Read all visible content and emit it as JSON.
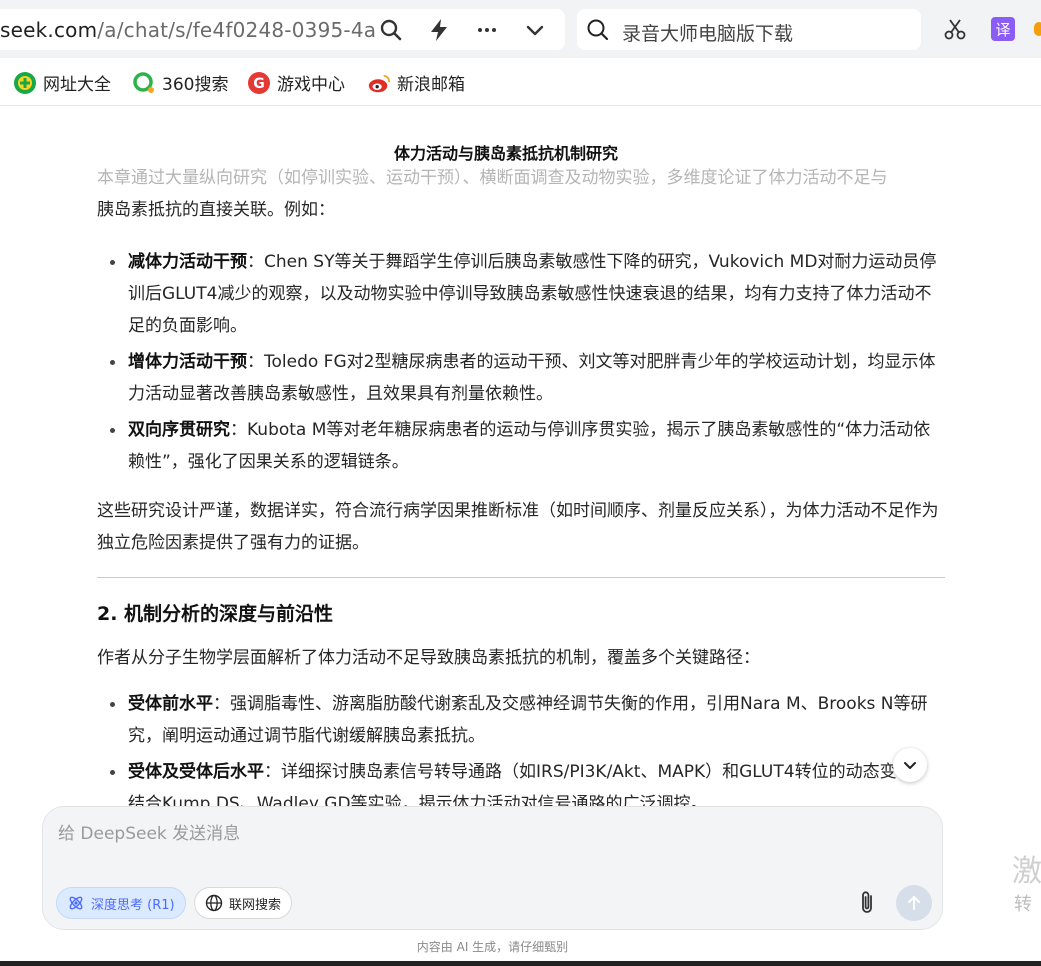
{
  "browser": {
    "url_host": "seek.com",
    "url_path": "/a/chat/s/fe4f0248-0395-4a",
    "search_placeholder": "录音大师电脑版下载",
    "translate_label": "译",
    "bookmarks": [
      {
        "label": "网址大全",
        "icon": "globe-plus-icon",
        "color": "#19a848"
      },
      {
        "label": "360搜索",
        "icon": "search-360-icon",
        "color": "#f5a623"
      },
      {
        "label": "游戏中心",
        "icon": "game-icon",
        "color": "#e53935"
      },
      {
        "label": "新浪邮箱",
        "icon": "sina-mail-icon",
        "color": "#e02e24"
      }
    ]
  },
  "document": {
    "title": "体力活动与胰岛素抵抗机制研究",
    "faded_line": "本章通过大量纵向研究（如停训实验、运动干预）、横断面调查及动物实验，多维度论证了体力活动不足与",
    "intro_rest": "胰岛素抵抗的直接关联。例如：",
    "bullets1": [
      {
        "bold": "减体力活动干预",
        "text": "：Chen SY等关于舞蹈学生停训后胰岛素敏感性下降的研究，Vukovich MD对耐力运动员停训后GLUT4减少的观察，以及动物实验中停训导致胰岛素敏感性快速衰退的结果，均有力支持了体力活动不足的负面影响。"
      },
      {
        "bold": "增体力活动干预",
        "text": "：Toledo FG对2型糖尿病患者的运动干预、刘文等对肥胖青少年的学校运动计划，均显示体力活动显著改善胰岛素敏感性，且效果具有剂量依赖性。"
      },
      {
        "bold": "双向序贯研究",
        "text": "：Kubota M等对老年糖尿病患者的运动与停训序贯实验，揭示了胰岛素敏感性的“体力活动依赖性”，强化了因果关系的逻辑链条。"
      }
    ],
    "conclusion": "这些研究设计严谨，数据详实，符合流行病学因果推断标准（如时间顺序、剂量反应关系），为体力活动不足作为独立危险因素提供了强有力的证据。",
    "section2_heading": "2. 机制分析的深度与前沿性",
    "section2_intro": "作者从分子生物学层面解析了体力活动不足导致胰岛素抵抗的机制，覆盖多个关键路径：",
    "bullets2": [
      {
        "bold": "受体前水平",
        "text": "：强调脂毒性、游离脂肪酸代谢紊乱及交感神经调节失衡的作用，引用Nara M、Brooks N等研究，阐明运动通过调节脂代谢缓解胰岛素抵抗。"
      },
      {
        "bold": "受体及受体后水平",
        "text": "：详细探讨胰岛素信号转导通路（如IRS/PI3K/Akt、MAPK）和GLUT4转位的动态变化，结合Kump DS、Wadley GD等实验，揭示体力活动对信号通路的广泛调控。"
      }
    ]
  },
  "composer": {
    "placeholder": "给 DeepSeek 发送消息",
    "deep_think_label": "深度思考 (R1)",
    "web_search_label": "联网搜索",
    "accent": "#4d6bfe"
  },
  "footer": {
    "disclaimer": "内容由 AI 生成，请仔细甄别"
  },
  "side_ad": {
    "line1": "激",
    "line2": "转"
  }
}
